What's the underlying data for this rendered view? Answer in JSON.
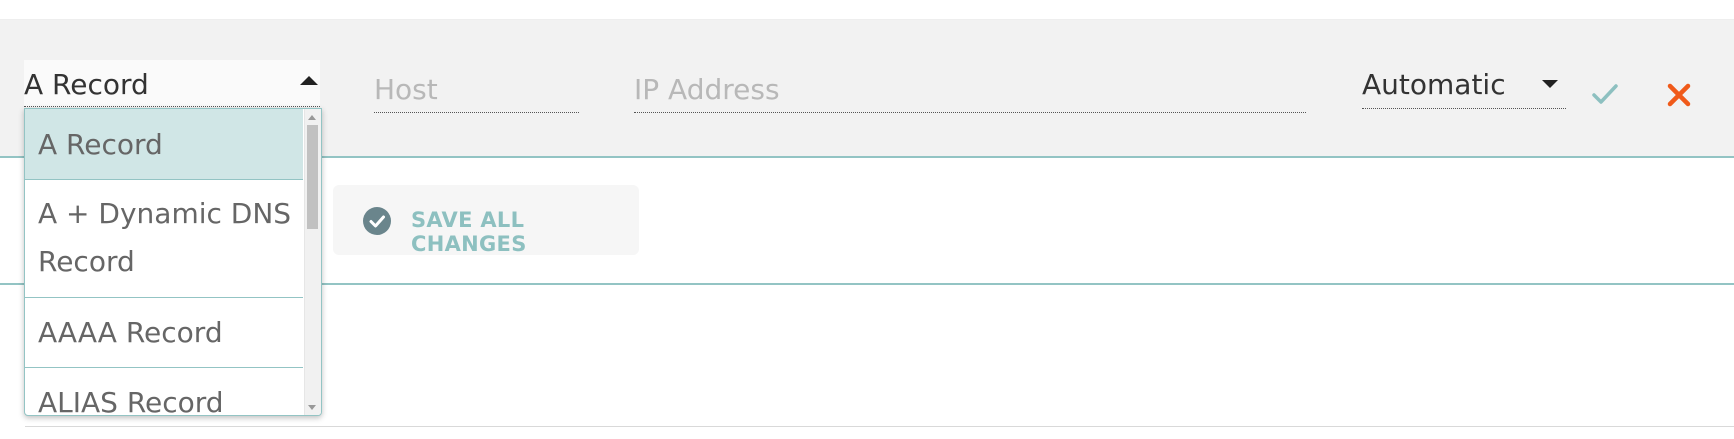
{
  "record_editor": {
    "type_select": {
      "value": "A Record"
    },
    "host_input": {
      "value": "",
      "placeholder": "Host"
    },
    "ip_input": {
      "value": "",
      "placeholder": "IP Address"
    },
    "ttl_select": {
      "value": "Automatic"
    },
    "confirm_icon": "check-icon",
    "cancel_icon": "close-icon",
    "colors": {
      "confirm": "#8dc0c0",
      "cancel": "#f05a1a",
      "accent": "#93c4c4"
    }
  },
  "type_dropdown": {
    "options": [
      "A Record",
      "A + Dynamic DNS Record",
      "AAAA Record",
      "ALIAS Record"
    ],
    "selected_index": 0
  },
  "actions": {
    "save_all_label": "SAVE ALL CHANGES",
    "save_icon": "check-circle-icon"
  }
}
